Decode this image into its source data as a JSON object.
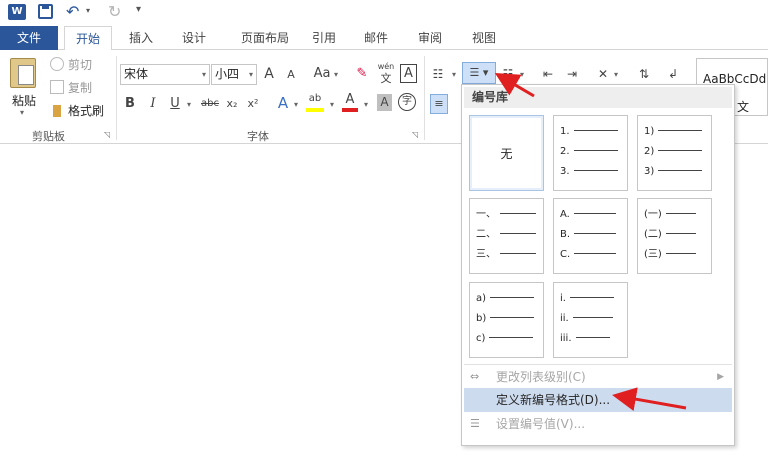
{
  "colors": {
    "accent": "#2b579a",
    "menu_hover": "#cddbef",
    "arrow": "#e02020"
  },
  "qat": {
    "app_icon": "W"
  },
  "tabs": [
    "文件",
    "开始",
    "插入",
    "设计",
    "页面布局",
    "引用",
    "邮件",
    "审阅",
    "视图"
  ],
  "clipboard": {
    "paste_label": "粘贴",
    "cut_label": "剪切",
    "copy_label": "复制",
    "format_painter_label": "格式刷",
    "group_label": "剪贴板"
  },
  "font": {
    "name": "宋体",
    "size": "小四",
    "grow": "A",
    "shrink": "A",
    "case": "Aa",
    "phonetic_top": "wén",
    "phonetic_bottom": "文",
    "border_char": "A",
    "bold": "B",
    "italic": "I",
    "underline": "U",
    "strike": "abc",
    "sub": "x₂",
    "sup": "x²",
    "effects": "A",
    "highlight": "ab",
    "color": "A",
    "shade": "A",
    "enclose": "字",
    "group_label": "字体"
  },
  "styles": {
    "preview": "AaBbCcDd",
    "partial_label": "文"
  },
  "numbering_menu": {
    "header": "编号库",
    "none_label": "无",
    "tiles": [
      [
        "1.",
        "2.",
        "3."
      ],
      [
        "1)",
        "2)",
        "3)"
      ],
      [
        "一、",
        "二、",
        "三、"
      ],
      [
        "A.",
        "B.",
        "C."
      ],
      [
        "(一)",
        "(二)",
        "(三)"
      ],
      [
        "a)",
        "b)",
        "c)"
      ],
      [
        "i.",
        "ii.",
        "iii."
      ]
    ],
    "change_level": "更改列表级别(C)",
    "define_new": "定义新编号格式(D)...",
    "set_value": "设置编号值(V)..."
  }
}
